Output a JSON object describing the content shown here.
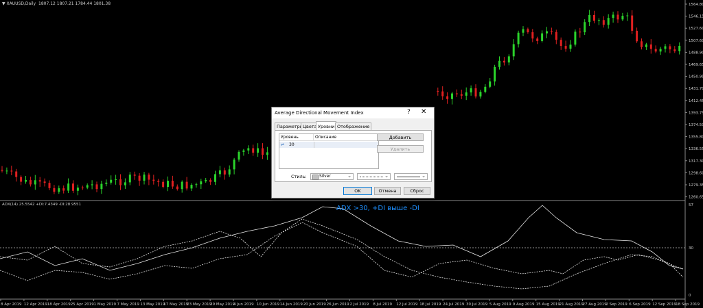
{
  "chart_header": {
    "symbol": "XAUUSD,Daily",
    "ohlc": "1807.12 1807.21 1784.44 1801.38"
  },
  "price_axis": [
    "1564.80",
    "1546.15",
    "1527.60",
    "1507.60",
    "1488.90",
    "1469.65",
    "1450.95",
    "1431.70",
    "1412.45",
    "1393.75",
    "1374.50",
    "1355.80",
    "1336.55",
    "1317.30",
    "1298.60",
    "1279.35",
    "1260.65"
  ],
  "indicator": {
    "label": "ADX(14) 25.5542 +DI:7.4349 -DI:28.9551",
    "annotation": "ADX >30, +DI выше -DI",
    "level": "30",
    "axis_top": "57",
    "axis_bottom": "0"
  },
  "date_axis": [
    "8 Apr 2019",
    "12 Apr 2019",
    "18 Apr 2019",
    "25 Apr 2019",
    "1 May 2019",
    "7 May 2019",
    "13 May 2019",
    "17 May 2019",
    "23 May 2019",
    "29 May 2019",
    "4 Jun 2019",
    "10 Jun 2019",
    "14 Jun 2019",
    "20 Jun 2019",
    "26 Jun 2019",
    "2 Jul 2019",
    "8 Jul 2019",
    "12 Jul 2019",
    "18 Jul 2019",
    "24 Jul 2019",
    "30 Jul 2019",
    "5 Aug 2019",
    "9 Aug 2019",
    "15 Aug 2019",
    "21 Aug 2019",
    "27 Aug 2019",
    "2 Sep 2019",
    "6 Sep 2019",
    "12 Sep 2019",
    "18 Sep 2019"
  ],
  "dialog": {
    "title": "Average Directional Movement Index",
    "help": "?",
    "close": "✕",
    "tabs": [
      "Параметры",
      "Цвета",
      "Уровни",
      "Отображение"
    ],
    "active_tab": "Уровни",
    "table": {
      "col_level": "Уровень",
      "col_desc": "Описание",
      "rows": [
        {
          "level": "30",
          "description": ""
        }
      ]
    },
    "add_button": "Добавить",
    "delete_button": "Удалить",
    "style_label": "Стиль:",
    "color_value": "Silver",
    "ok": "OK",
    "cancel": "Отмена",
    "reset": "Сброс"
  },
  "colors": {
    "bull": "#2bd42b",
    "bear": "#e02020",
    "level": "#c0c0c0",
    "annotation": "#1e90ff"
  }
}
